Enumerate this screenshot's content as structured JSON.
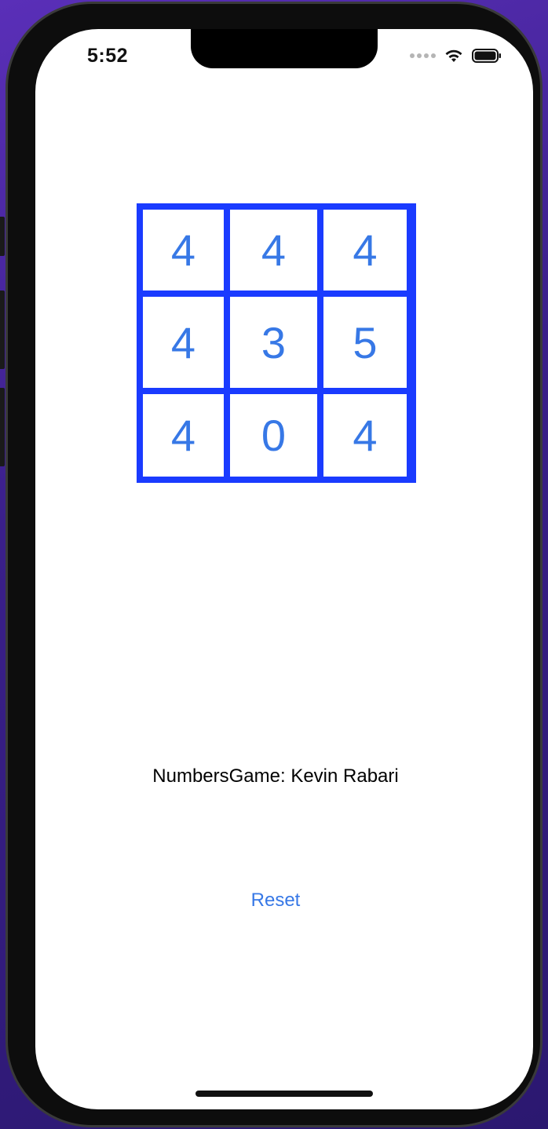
{
  "status_bar": {
    "time": "5:52"
  },
  "icons": {
    "wifi": "wifi-icon",
    "battery": "battery-icon",
    "signal": "signal-dots-icon"
  },
  "grid": {
    "cells": [
      "4",
      "4",
      "4",
      "4",
      "3",
      "5",
      "4",
      "0",
      "4"
    ]
  },
  "title": "NumbersGame: Kevin Rabari",
  "reset_label": "Reset",
  "colors": {
    "grid_border": "#1a3bff",
    "number_text": "#3778e6",
    "link": "#3778e6"
  }
}
